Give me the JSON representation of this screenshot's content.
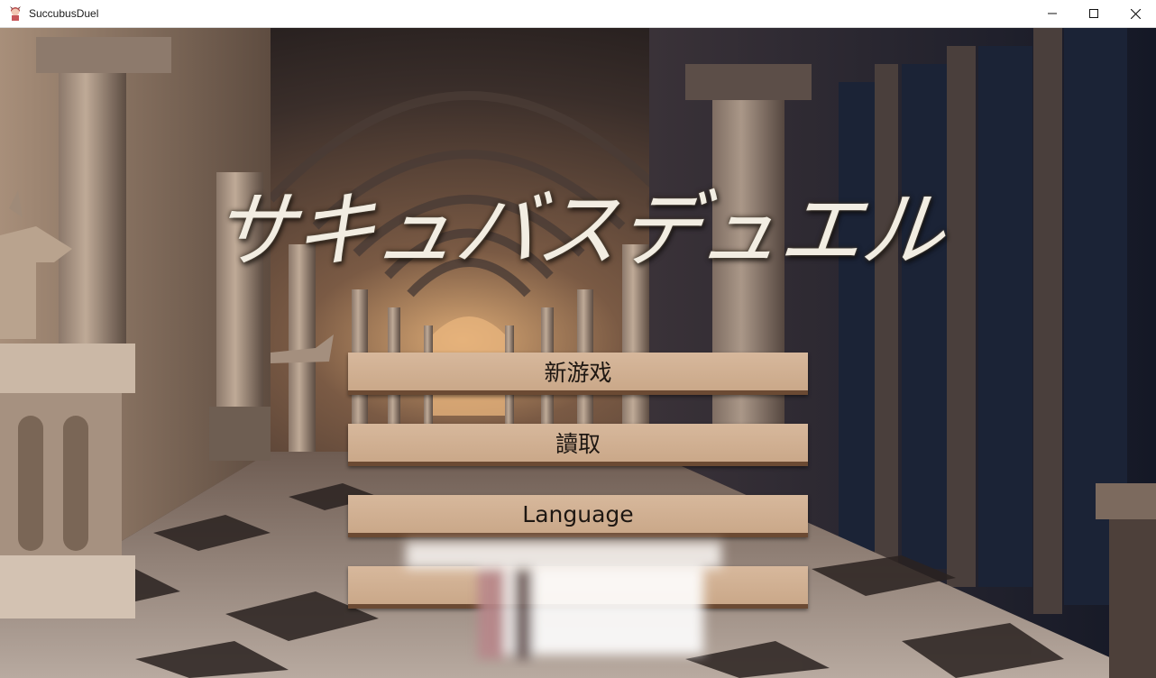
{
  "window": {
    "title": "SuccubusDuel",
    "icon": "app-character-icon",
    "controls": [
      "minimize-icon",
      "maximize-icon",
      "close-icon"
    ]
  },
  "game": {
    "title": "サキュバスデュエル"
  },
  "menu": {
    "new_game": "新游戏",
    "load": "讀取",
    "language": "Language",
    "blurred_item": ""
  },
  "colors": {
    "button_face": "#d0b090",
    "button_edge": "#6b4a33",
    "title_text": "#f2ede2"
  }
}
